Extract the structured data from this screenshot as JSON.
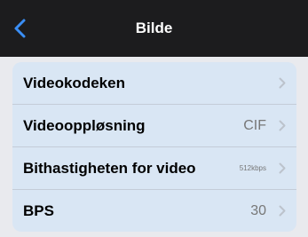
{
  "nav": {
    "title": "Bilde",
    "back_icon": "chevron-left-icon"
  },
  "colors": {
    "accent": "#3a8ef6",
    "nav_bg": "#1c1c1e",
    "group_bg": "#d9e6f4",
    "page_bg": "#e9eaee"
  },
  "settings": {
    "rows": [
      {
        "label": "Videokodeken",
        "value": ""
      },
      {
        "label": "Videooppløsning",
        "value": "CIF"
      },
      {
        "label": "Bithastigheten for video",
        "value": "512kbps"
      },
      {
        "label": "BPS",
        "value": "30"
      }
    ]
  }
}
